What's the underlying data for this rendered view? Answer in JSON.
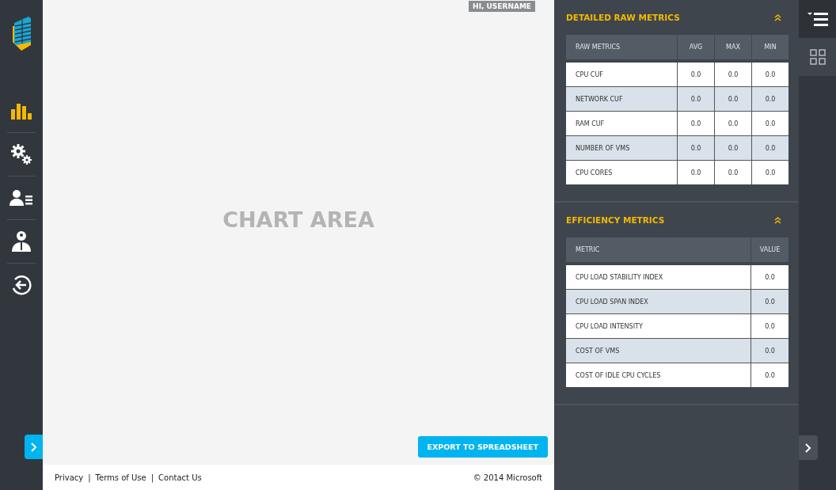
{
  "nav": {
    "items": [
      {
        "kind": "chart",
        "selected": true
      },
      {
        "kind": "settings",
        "selected": false
      },
      {
        "kind": "users",
        "selected": false
      },
      {
        "kind": "admin",
        "selected": false
      },
      {
        "kind": "logout",
        "selected": false
      }
    ]
  },
  "main": {
    "greeting": "HI, USERNAME",
    "chart_placeholder": "CHART AREA",
    "export_button": "EXPORT TO SPREADSHEET"
  },
  "footer": {
    "links": [
      "Privacy",
      "Terms of Use",
      "Contact Us"
    ],
    "separators": [
      "|",
      "|"
    ],
    "copyright": "© 2014 Microsoft"
  },
  "panels": [
    {
      "title": "DETAILED RAW METRICS",
      "expanded": true,
      "columns": [
        "RAW METRICS",
        "AVG",
        "MAX",
        "MIN"
      ],
      "rows": [
        [
          "CPU CUF",
          "0.0",
          "0.0",
          "0.0"
        ],
        [
          "NETWORK CUF",
          "0.0",
          "0.0",
          "0.0"
        ],
        [
          "RAM CUF",
          "0.0",
          "0.0",
          "0.0"
        ],
        [
          "NUMBER OF VMS",
          "0.0",
          "0.0",
          "0.0"
        ],
        [
          "CPU CORES",
          "0.0",
          "0.0",
          "0.0"
        ]
      ]
    },
    {
      "title": "EFFICIENCY METRICS",
      "expanded": true,
      "columns": [
        "METRIC",
        "VALUE"
      ],
      "rows": [
        [
          "CPU LOAD STABILITY INDEX",
          "0.0"
        ],
        [
          "CPU LOAD SPAN INDEX",
          "0.0"
        ],
        [
          "CPU LOAD INTENSITY",
          "0.0"
        ],
        [
          "COST OF VMS",
          "0.0"
        ],
        [
          "COST OF IDLE CPU CYCLES",
          "0.0"
        ]
      ]
    }
  ],
  "view_tabs": [
    {
      "kind": "list",
      "selected": false
    },
    {
      "kind": "grid",
      "selected": true
    }
  ]
}
